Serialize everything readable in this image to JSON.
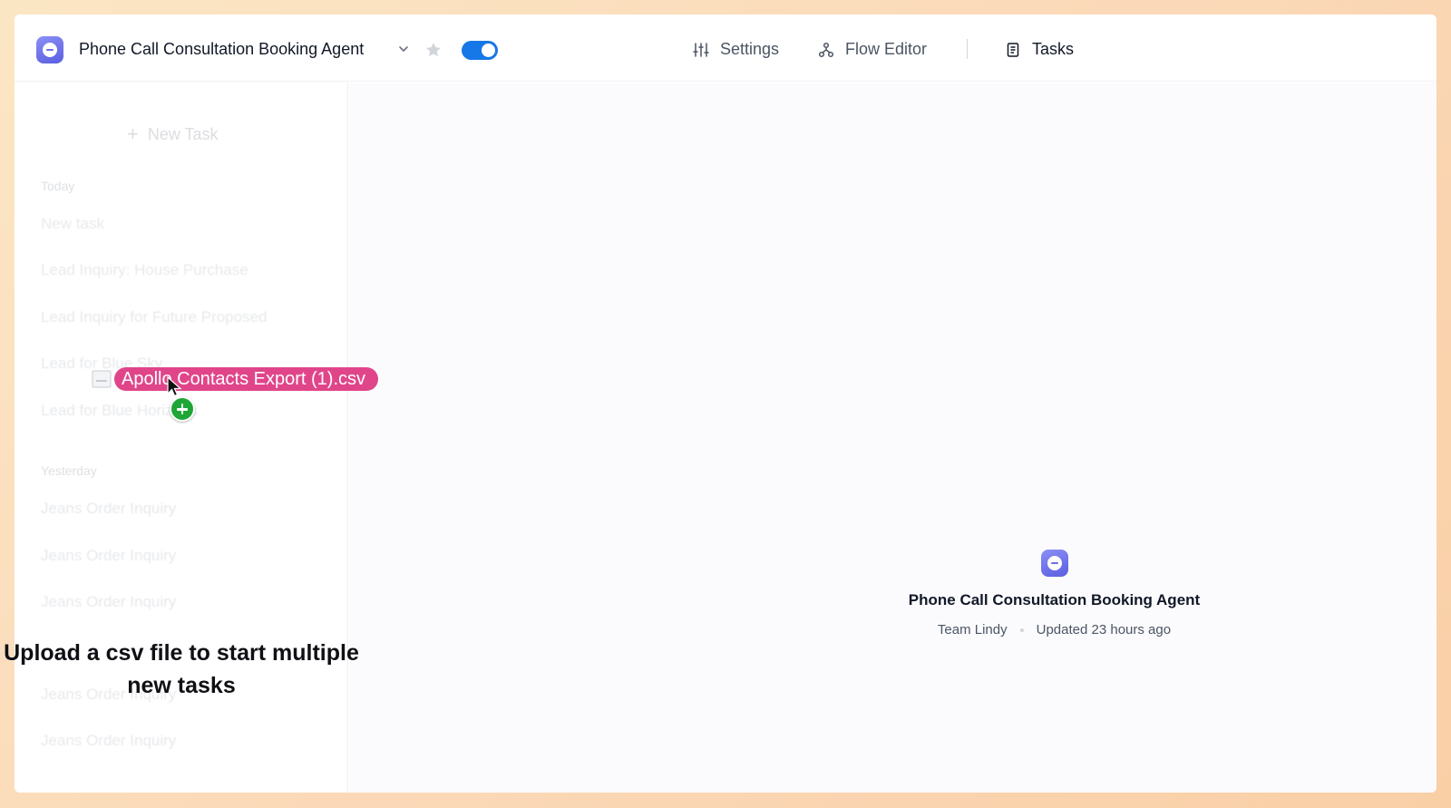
{
  "header": {
    "agent_title": "Phone Call Consultation Booking Agent",
    "nav": {
      "settings": "Settings",
      "flow_editor": "Flow Editor",
      "tasks": "Tasks"
    },
    "toggle_on": true
  },
  "sidebar": {
    "new_task_label": "New Task",
    "sections": [
      {
        "label": "Today",
        "items": [
          "New task",
          "Lead Inquiry: House Purchase",
          "Lead Inquiry for Future Proposed",
          "Lead for Blue Sky",
          "Lead for Blue Horizons"
        ]
      },
      {
        "label": "Yesterday",
        "items": [
          "Jeans Order Inquiry",
          "Jeans Order Inquiry",
          "Jeans Order Inquiry",
          "Jeans Order Inquiry",
          "Jeans Order Inquiry"
        ]
      }
    ]
  },
  "main": {
    "card_title": "Phone Call Consultation Booking Agent",
    "team": "Team Lindy",
    "updated": "Updated 23 hours ago"
  },
  "overlay": {
    "caption": "Upload a csv file to start multiple new tasks",
    "dragged_file": "Apollo Contacts Export (1).csv"
  },
  "colors": {
    "accent": "#1677e6",
    "drag_pill": "#e0458a",
    "plus_badge": "#1ea637",
    "icon_gradient": "#6d70e8"
  }
}
